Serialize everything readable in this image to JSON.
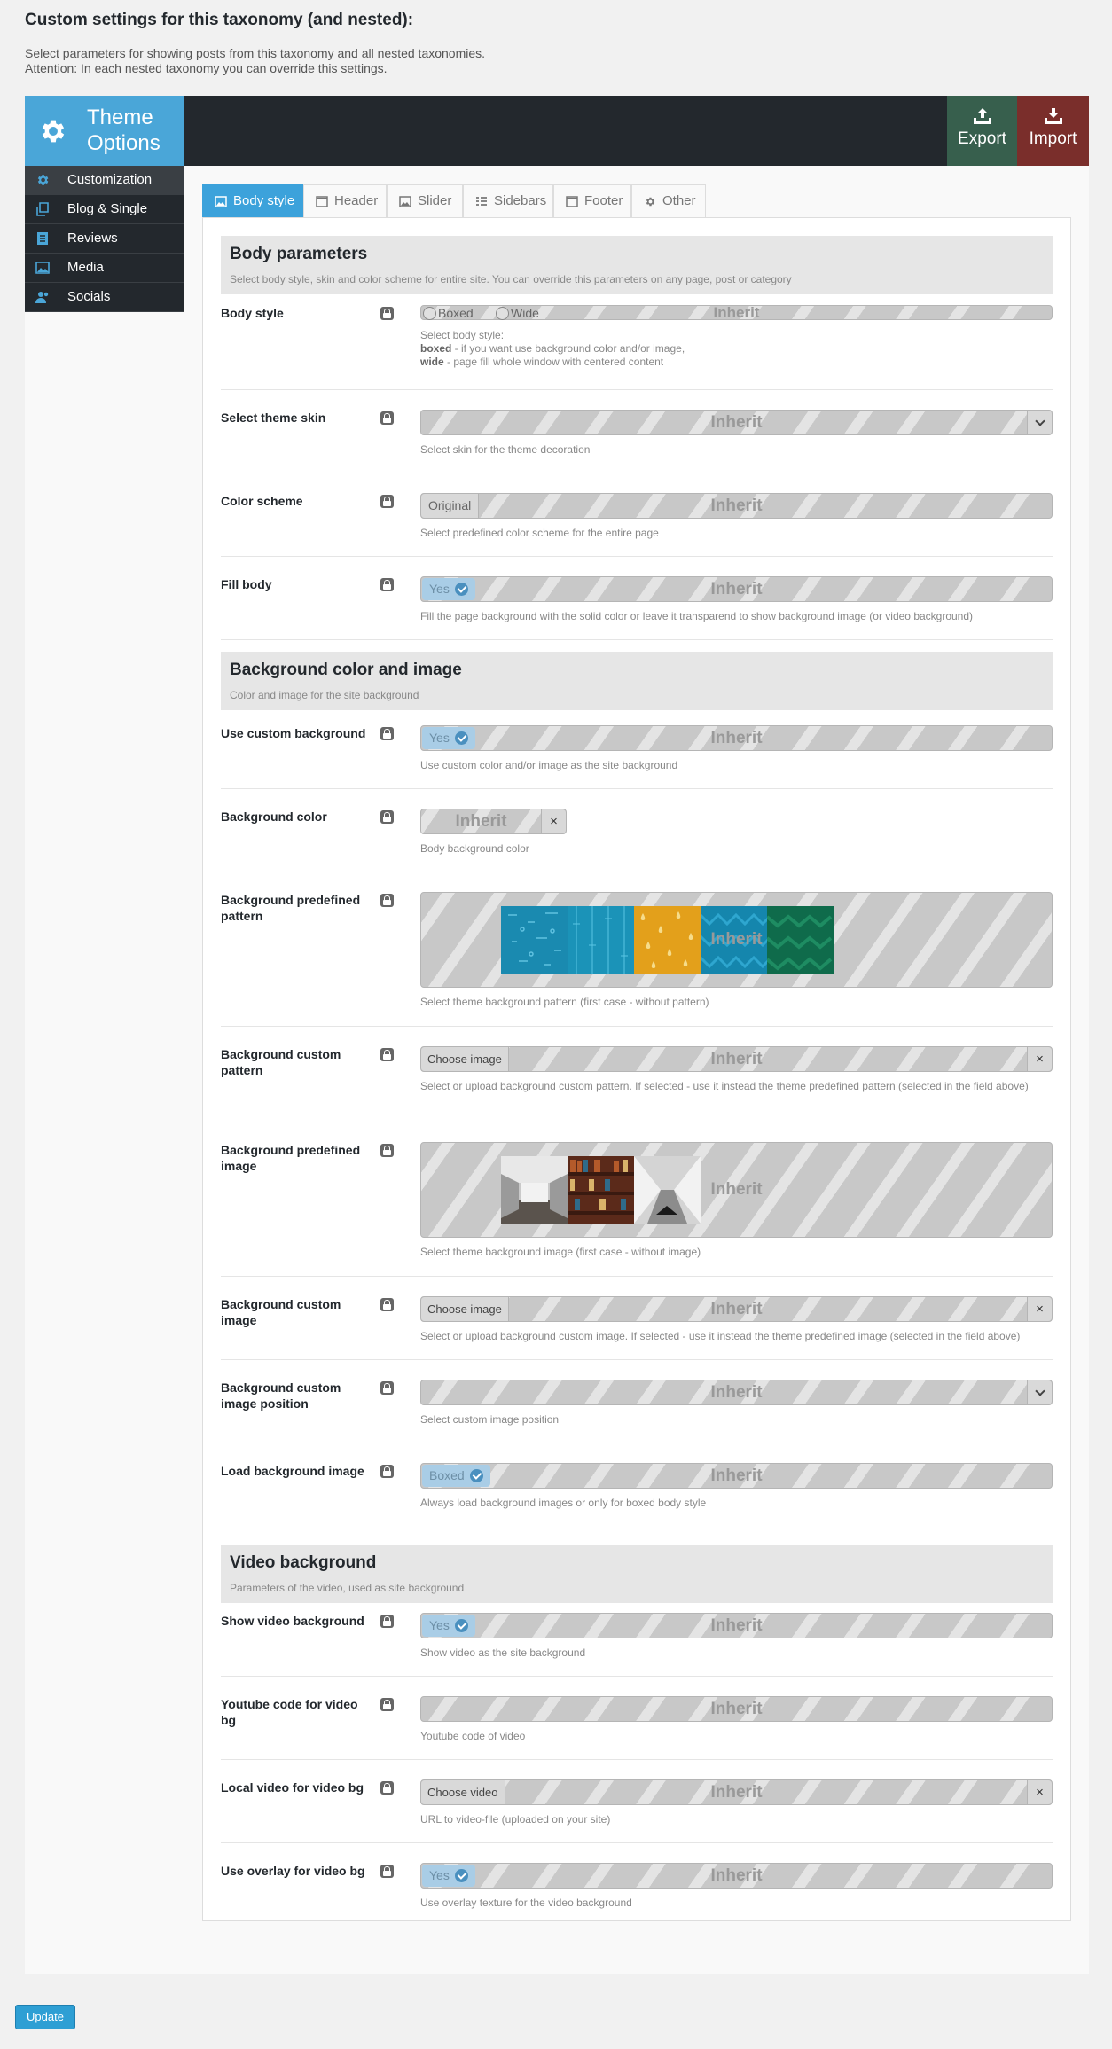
{
  "intro": {
    "title": "Custom settings for this taxonomy (and nested):",
    "line1": "Select parameters for showing posts from this taxonomy and all nested taxonomies.",
    "line2": "Attention: In each nested taxonomy you can override this settings."
  },
  "header": {
    "logo_line1": "Theme",
    "logo_line2": "Options",
    "export_label": "Export",
    "import_label": "Import"
  },
  "sidebar": {
    "items": [
      {
        "label": "Customization",
        "icon": "gear-icon",
        "active": true
      },
      {
        "label": "Blog & Single",
        "icon": "copy-icon"
      },
      {
        "label": "Reviews",
        "icon": "document-icon"
      },
      {
        "label": "Media",
        "icon": "image-icon"
      },
      {
        "label": "Socials",
        "icon": "users-icon"
      }
    ]
  },
  "tabs": [
    {
      "label": "Body style",
      "icon": "image-icon",
      "active": true
    },
    {
      "label": "Header",
      "icon": "window-icon"
    },
    {
      "label": "Slider",
      "icon": "image-icon"
    },
    {
      "label": "Sidebars",
      "icon": "list-icon"
    },
    {
      "label": "Footer",
      "icon": "window-icon"
    },
    {
      "label": "Other",
      "icon": "gear-icon"
    }
  ],
  "inherit_label": "Inherit",
  "sections": {
    "body": {
      "title": "Body parameters",
      "desc": "Select body style, skin and color scheme for entire site. You can override this parameters on any page, post or category"
    },
    "background": {
      "title": "Background color and image",
      "desc": "Color and image for the site background"
    },
    "video": {
      "title": "Video background",
      "desc": "Parameters of the video, used as site background"
    }
  },
  "fields": {
    "body_style": {
      "label": "Body style",
      "options": [
        "Boxed",
        "Wide"
      ],
      "desc_line1": "Select body style:",
      "desc_boxed_key": "boxed",
      "desc_boxed_text": " - if you want use background color and/or image,",
      "desc_wide_key": "wide",
      "desc_wide_text": " - page fill whole window with centered content"
    },
    "theme_skin": {
      "label": "Select theme skin",
      "desc": "Select skin for the theme decoration"
    },
    "color_scheme": {
      "label": "Color scheme",
      "value": "Original",
      "desc": "Select predefined color scheme for the entire page"
    },
    "fill_body": {
      "label": "Fill body",
      "value": "Yes",
      "desc": "Fill the page background with the solid color or leave it transparend to show background image (or video background)"
    },
    "use_custom_bg": {
      "label": "Use custom background",
      "value": "Yes",
      "desc": "Use custom color and/or image as the site background"
    },
    "bg_color": {
      "label": "Background color",
      "clear": "×",
      "desc": "Body background color"
    },
    "bg_pattern": {
      "label": "Background predefined pattern",
      "desc": "Select theme background pattern (first case - without pattern)"
    },
    "bg_custom_pattern": {
      "label": "Background custom pattern",
      "button": "Choose image",
      "clear": "×",
      "desc": "Select or upload background custom pattern. If selected - use it instead the theme predefined pattern (selected in the field above)"
    },
    "bg_image": {
      "label": "Background predefined image",
      "desc": "Select theme background image (first case - without image)"
    },
    "bg_custom_image": {
      "label": "Background custom image",
      "button": "Choose image",
      "clear": "×",
      "desc": "Select or upload background custom image. If selected - use it instead the theme predefined image (selected in the field above)"
    },
    "bg_image_position": {
      "label": "Background custom image position",
      "desc": "Select custom image position"
    },
    "load_bg_image": {
      "label": "Load background image",
      "value": "Boxed",
      "desc": "Always load background images or only for boxed body style"
    },
    "show_video_bg": {
      "label": "Show video background",
      "value": "Yes",
      "desc": "Show video as the site background"
    },
    "youtube_code": {
      "label": "Youtube code for video bg",
      "desc": "Youtube code of video"
    },
    "local_video": {
      "label": "Local video for video bg",
      "button": "Choose video",
      "clear": "×",
      "desc": "URL to video-file (uploaded on your site)"
    },
    "video_overlay": {
      "label": "Use overlay for video bg",
      "value": "Yes",
      "desc": "Use overlay texture for the video background"
    }
  },
  "update_label": "Update",
  "colors": {
    "accent": "#3ca2db",
    "topbar": "#23282d",
    "export": "#375f4d",
    "import": "#7a2e2b"
  }
}
